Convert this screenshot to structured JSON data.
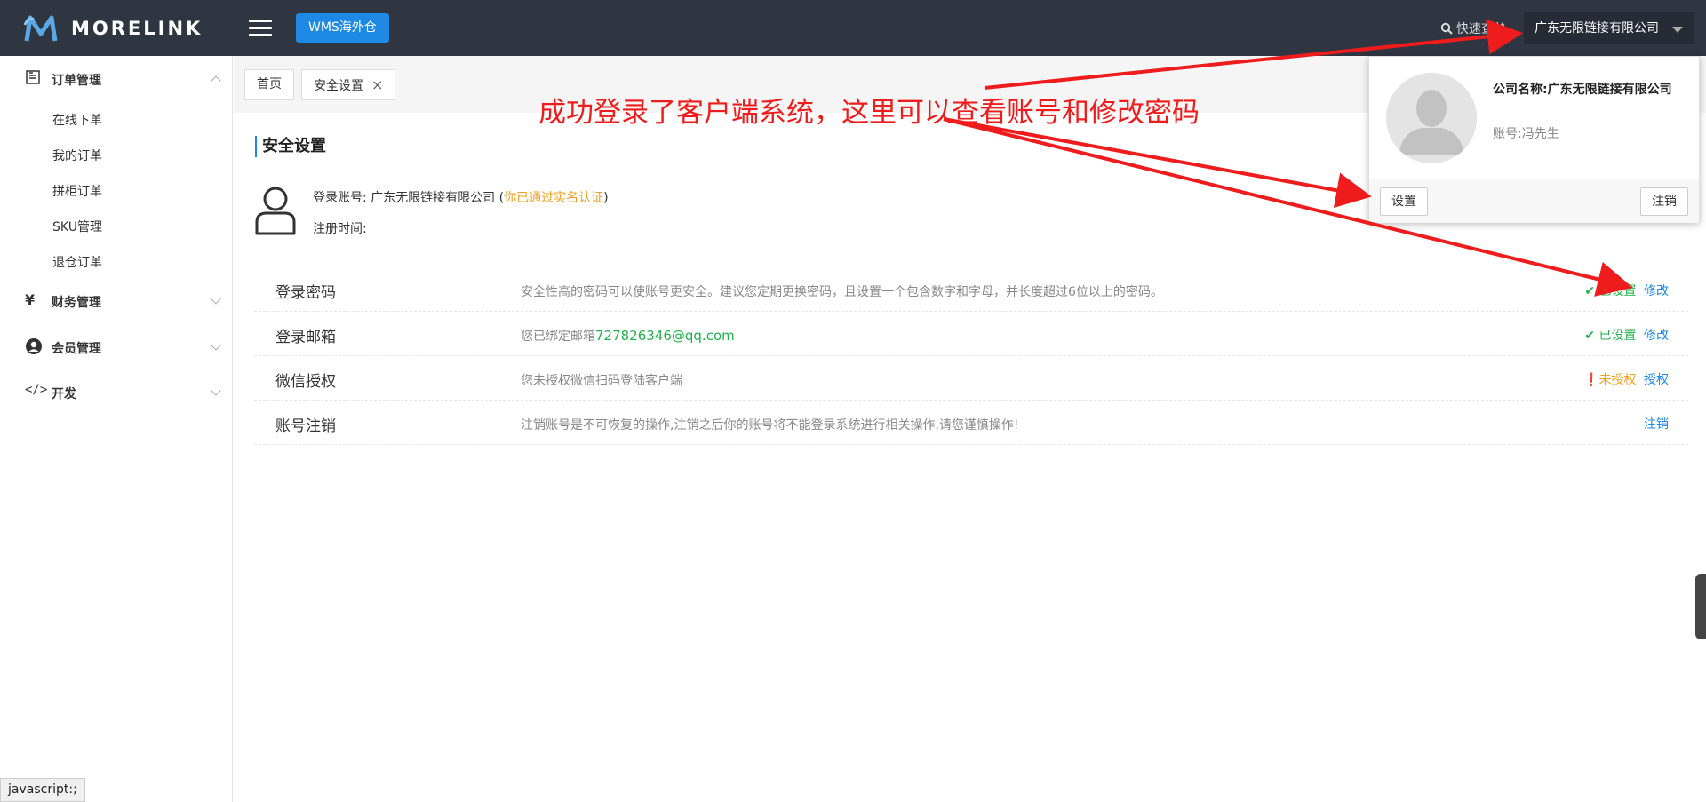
{
  "header": {
    "logo_text": "MORELINK",
    "wms_button": "WMS海外仓",
    "quick_search": "快速查单",
    "company_button": "广东无限链接有限公司"
  },
  "sidebar": {
    "groups": [
      {
        "label": "订单管理",
        "icon": "order-icon",
        "expanded": true,
        "items": [
          "在线下单",
          "我的订单",
          "拼柜订单",
          "SKU管理",
          "退仓订单"
        ]
      },
      {
        "label": "财务管理",
        "icon": "yen-icon"
      },
      {
        "label": "会员管理",
        "icon": "member-icon"
      },
      {
        "label": "开发",
        "icon": "code-icon"
      }
    ]
  },
  "tabs": [
    {
      "label": "首页"
    },
    {
      "label": "安全设置",
      "closable": true
    }
  ],
  "content": {
    "title": "安全设置",
    "account_label": "登录账号:",
    "account_value": "广东无限链接有限公司",
    "verified_open": " (",
    "verified_text": "你已通过实名认证",
    "verified_close": ")",
    "register_label": "注册时间:",
    "rows": [
      {
        "name": "登录密码",
        "desc": "安全性高的密码可以使账号更安全。建议您定期更换密码，且设置一个包含数字和字母，并长度超过6位以上的密码。",
        "status_icon": "check-icon",
        "status": "已设置",
        "action": "修改"
      },
      {
        "name": "登录邮箱",
        "desc_prefix": "您已绑定邮箱",
        "email": "727826346@qq.com",
        "status_icon": "check-icon",
        "status": "已设置",
        "action": "修改"
      },
      {
        "name": "微信授权",
        "desc": "您未授权微信扫码登陆客户端",
        "status_icon": "warning-icon",
        "status": "未授权",
        "action": "授权"
      },
      {
        "name": "账号注销",
        "desc": "注销账号是不可恢复的操作,注销之后你的账号将不能登录系统进行相关操作,请您谨慎操作!",
        "action": "注销"
      }
    ]
  },
  "dropdown": {
    "company": "公司名称:广东无限链接有限公司",
    "account": "账号:冯先生",
    "settings_button": "设置",
    "logout_button": "注销"
  },
  "annotation": "成功登录了客户端系统，这里可以查看账号和修改密码",
  "status_bar": "javascript:;",
  "colors": {
    "topbar": "#2f3541",
    "accent": "#1e88e5",
    "success": "#22b14c",
    "warning": "#f0a020",
    "annotation": "#ee1c1c"
  }
}
